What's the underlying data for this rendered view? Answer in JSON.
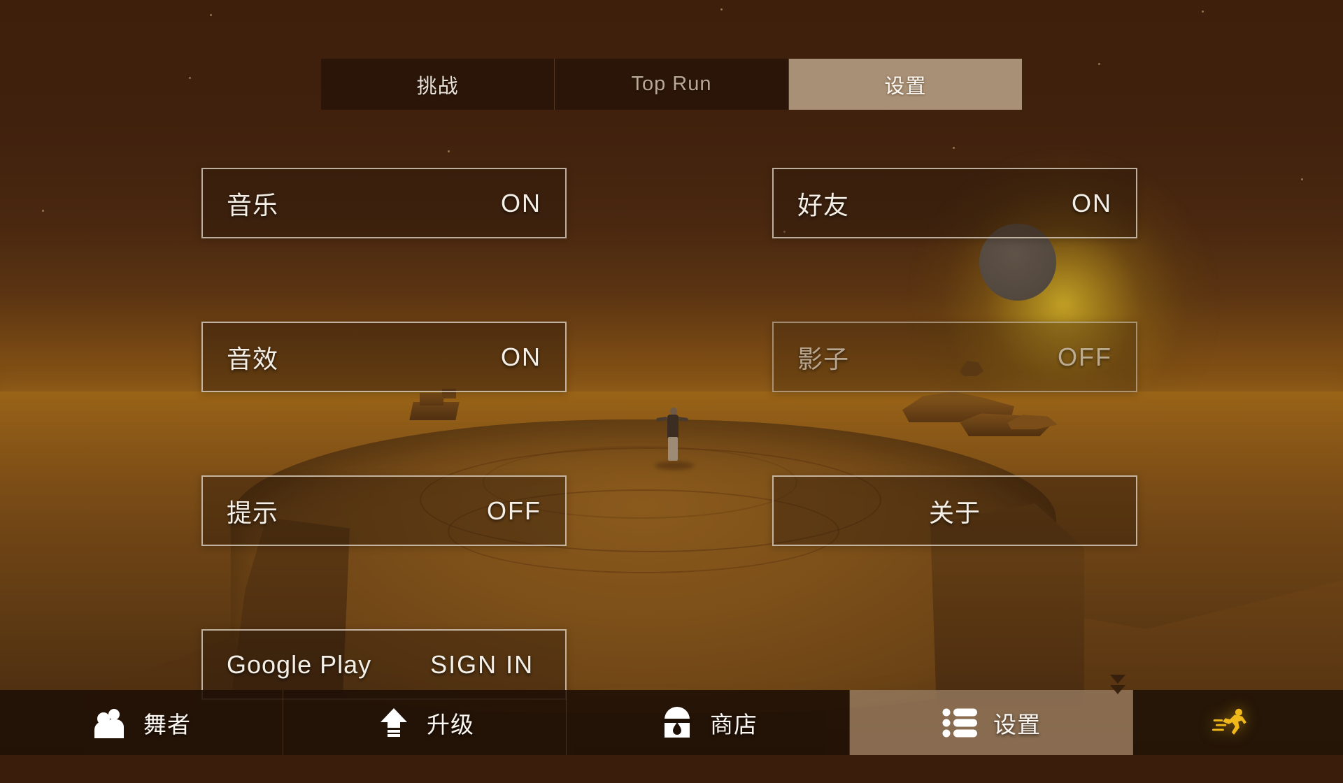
{
  "tabs": [
    {
      "label": "挑战",
      "state": "inactive"
    },
    {
      "label": "Top Run",
      "state": "inactive-dim"
    },
    {
      "label": "设置",
      "state": "active"
    }
  ],
  "settings": {
    "left_column": [
      {
        "label": "音乐",
        "value": "ON",
        "enabled": true,
        "layout": "label-value"
      },
      {
        "label": "音效",
        "value": "ON",
        "enabled": true,
        "layout": "label-value"
      },
      {
        "label": "提示",
        "value": "OFF",
        "enabled": true,
        "layout": "label-value"
      },
      {
        "label": "Google Play",
        "value": "SIGN IN",
        "enabled": true,
        "layout": "label-value-near"
      }
    ],
    "right_column": [
      {
        "label": "好友",
        "value": "ON",
        "enabled": true,
        "layout": "label-value"
      },
      {
        "label": "影子",
        "value": "OFF",
        "enabled": false,
        "layout": "label-value"
      },
      {
        "label": "关于",
        "value": "",
        "enabled": true,
        "layout": "centered"
      }
    ]
  },
  "bottom_nav": [
    {
      "label": "舞者",
      "icon": "two-people-icon",
      "active": false
    },
    {
      "label": "升级",
      "icon": "up-arrow-icon",
      "active": false
    },
    {
      "label": "商店",
      "icon": "chest-icon",
      "active": false
    },
    {
      "label": "设置",
      "icon": "list-icon",
      "active": true
    }
  ],
  "run_button": {
    "icon": "running-person-icon",
    "label": ""
  },
  "colors": {
    "sky": "#3d1f0c",
    "ground": "#7d4e16",
    "sun_glow": "#d2b228",
    "active_tab_bg": "#b79f85",
    "row_border": "#e2d6c6",
    "text": "#f4efe7",
    "run_icon": "#f0b81b",
    "nav_bg": "#1f1006",
    "nav_active_bg": "#967a60"
  }
}
